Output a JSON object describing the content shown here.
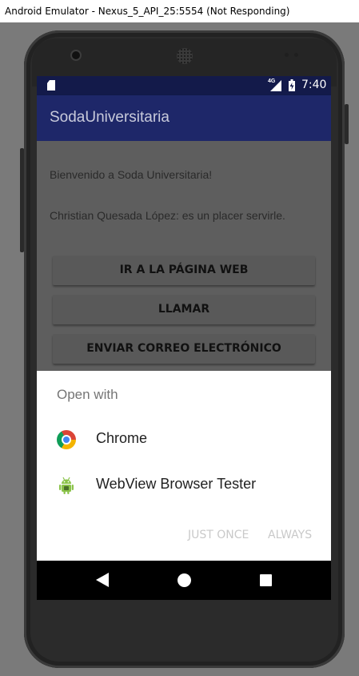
{
  "window": {
    "title": "Android Emulator - Nexus_5_API_25:5554 (Not Responding)"
  },
  "status_bar": {
    "network": "4G",
    "time": "7:40"
  },
  "app_bar": {
    "title": "SodaUniversitaria"
  },
  "content": {
    "welcome": "Bienvenido a Soda Universitaria!",
    "greeting": "Christian Quesada López: es un placer servirle.",
    "buttons": [
      "IR A LA PÁGINA WEB",
      "LLAMAR",
      "ENVIAR CORREO ELECTRÓNICO"
    ]
  },
  "chooser": {
    "title": "Open with",
    "apps": [
      {
        "label": "Chrome",
        "icon": "chrome-icon"
      },
      {
        "label": "WebView Browser Tester",
        "icon": "android-icon"
      }
    ],
    "actions": {
      "just_once": "JUST ONCE",
      "always": "ALWAYS"
    }
  },
  "colors": {
    "app_bar": "#1e2769",
    "status_bar": "#131a4a",
    "scrim": "#5e5e5e",
    "android_green": "#8bc34a"
  },
  "nav_bar": {
    "icons": [
      "back-icon",
      "home-icon",
      "recents-icon"
    ]
  }
}
